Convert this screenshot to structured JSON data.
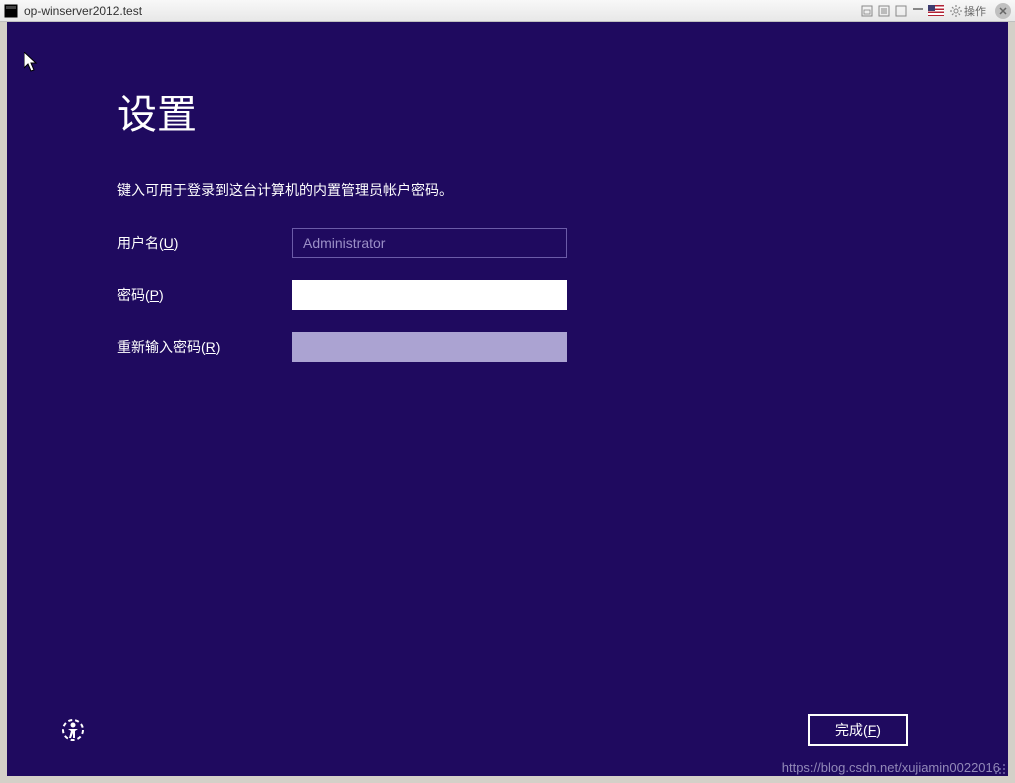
{
  "titlebar": {
    "title": "op-winserver2012.test",
    "action_label": "操作"
  },
  "setup": {
    "title": "设置",
    "subtitle": "键入可用于登录到这台计算机的内置管理员帐户密码。",
    "username_label_prefix": "用户名(",
    "username_label_key": "U",
    "username_label_suffix": ")",
    "username_value": "Administrator",
    "password_label_prefix": "密码(",
    "password_label_key": "P",
    "password_label_suffix": ")",
    "password_value": "",
    "confirm_label_prefix": "重新输入密码(",
    "confirm_label_key": "R",
    "confirm_label_suffix": ")",
    "confirm_value": ""
  },
  "footer": {
    "finish_label_prefix": "完成(",
    "finish_label_key": "F",
    "finish_label_suffix": ")"
  },
  "watermark": "https://blog.csdn.net/xujiamin0022016"
}
